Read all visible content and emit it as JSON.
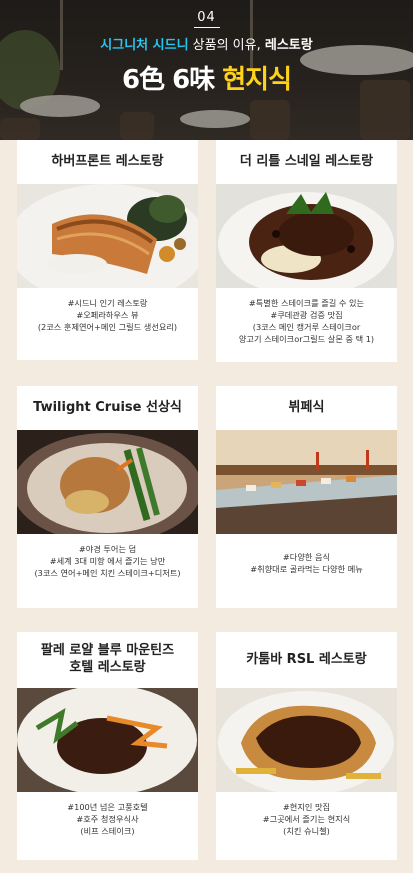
{
  "hero": {
    "number": "04",
    "subtitle_accent": "시그니처 시드니",
    "subtitle_rest": " 상품의 이유, ",
    "subtitle_bold": "레스토랑",
    "title_main": "6色 6味 ",
    "title_accent": "현지식"
  },
  "cards": [
    {
      "title": "하버프론트 레스토랑",
      "desc": [
        "#시드니 인기 레스토랑",
        "#오페라하우스 뷰",
        "(2코스 훈제연어+메인 그릴드 생선요리)"
      ]
    },
    {
      "title": "더 리틀 스네일 레스토랑",
      "desc": [
        "#특별한 스테이크를 즐길 수 있는",
        "#쿠데관광 검증 맛집",
        "(3코스 메인 캥거루 스테이크or",
        "양고기 스테이크or그릴드 살몬 중 택 1)"
      ]
    },
    {
      "title": "Twilight Cruise 선상식",
      "desc": [
        "#야경 투어는 덤",
        "#세계 3대 미항 에서 즐기는 낭만",
        "(3코스 연어+메인 치킨 스테이크+디저트)"
      ]
    },
    {
      "title": "뷔페식",
      "desc": [
        "#다양한 음식",
        "#취향대로 골라먹는 다양한 메뉴"
      ]
    },
    {
      "title_line1": "팔레 로얄 블루 마운틴즈",
      "title_line2": "호텔 레스토랑",
      "desc": [
        "#100년 넘은 고풍호텔",
        "#호주 청정우식사",
        "(비프 스테이크)"
      ]
    },
    {
      "title": "카툼바 RSL 레스토랑",
      "desc": [
        "#현지인 맛집",
        "#그곳에서 즐기는 현지식",
        "(치킨 슈니첼)"
      ]
    }
  ]
}
